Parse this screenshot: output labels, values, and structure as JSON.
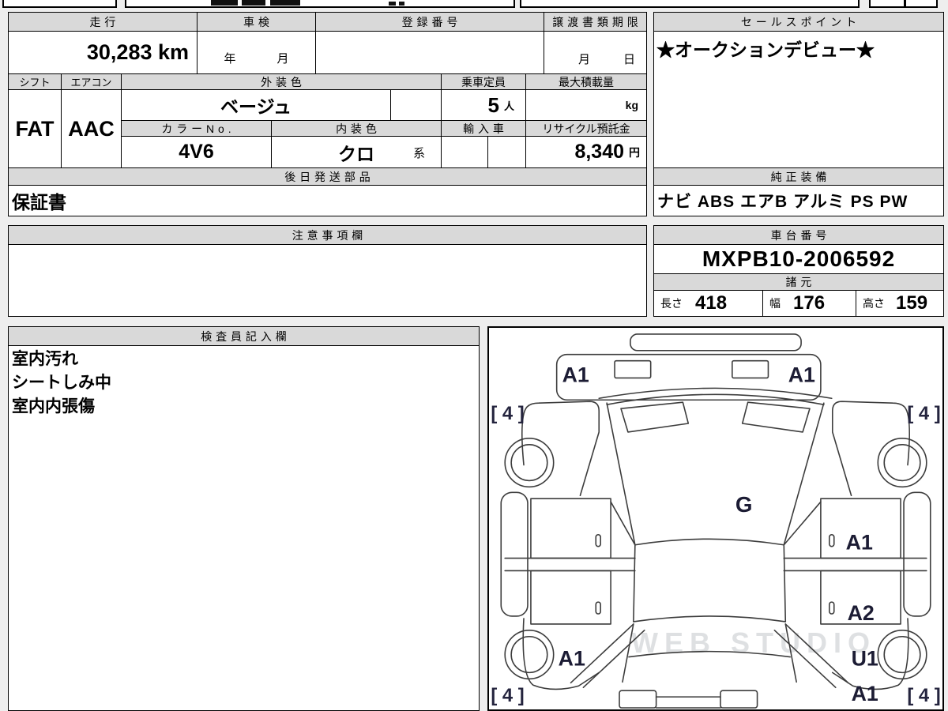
{
  "vehicle_table": {
    "mileage": {
      "header": "走行",
      "value": "30,283 km"
    },
    "shaken": {
      "header": "車検",
      "year_label": "年",
      "month_label": "月"
    },
    "registration": {
      "header": "登録番号",
      "value": ""
    },
    "transfer_deadline": {
      "header": "譲渡書類期限",
      "month_label": "月",
      "day_label": "日"
    },
    "shift": {
      "header": "シフト",
      "value": "FAT"
    },
    "aircon": {
      "header": "エアコン",
      "value": "AAC"
    },
    "exterior_color": {
      "header": "外装色",
      "value": "ベージュ"
    },
    "capacity": {
      "header": "乗車定員",
      "value": "5",
      "unit": "人"
    },
    "max_load": {
      "header": "最大積載量",
      "value": "",
      "unit": "kg"
    },
    "color_no": {
      "header": "カラーNo.",
      "value": "4V6"
    },
    "interior_color": {
      "header": "内装色",
      "value": "クロ",
      "suffix": "系"
    },
    "import_car": {
      "header": "輸入車",
      "value": ""
    },
    "recycle_fee": {
      "header": "リサイクル預託金",
      "value": "8,340",
      "unit": "円"
    },
    "later_parts": {
      "header": "後日発送部品",
      "value": "保証書"
    }
  },
  "sales_point": {
    "header": "セールスポイント",
    "value": "★オークションデビュー★"
  },
  "genuine_equipment": {
    "header": "純正装備",
    "value": "ナビ ABS エアB アルミ PS PW"
  },
  "notes": {
    "header": "注意事項欄",
    "value": ""
  },
  "chassis": {
    "header": "車台番号",
    "value": "MXPB10-2006592"
  },
  "specs": {
    "header": "諸元",
    "length_label": "長さ",
    "length": "418",
    "width_label": "幅",
    "width": "176",
    "height_label": "高さ",
    "height": "159"
  },
  "inspector": {
    "header": "検査員記入欄",
    "lines": [
      "室内汚れ",
      "シートしみ中",
      "室内内張傷"
    ]
  },
  "diagram": {
    "watermark": "WEB STUDIO",
    "marks": {
      "front_left": "A1",
      "front_right": "A1",
      "tire_front_left": "[ 4 ]",
      "tire_front_right": "[ 4 ]",
      "tire_rear_left": "[ 4 ]",
      "tire_rear_right": "[ 4 ]",
      "windshield": "G",
      "front_door_right": "A1",
      "rear_door_right": "A2",
      "rear_wheel_left": "A1",
      "rear_wheel_right": "U1",
      "rear_gate_right": "A1"
    }
  }
}
